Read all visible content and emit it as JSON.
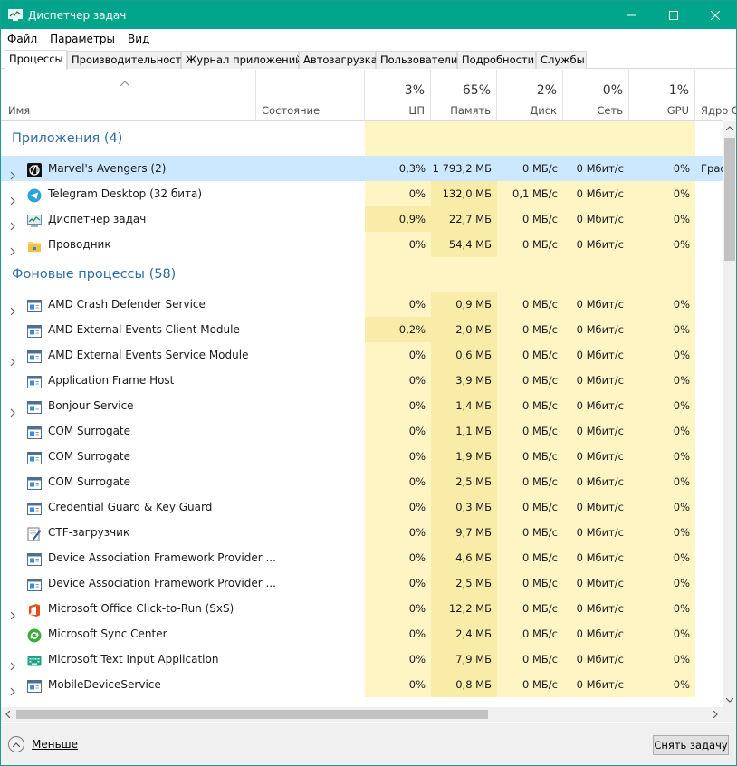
{
  "window": {
    "title": "Диспетчер задач"
  },
  "menu": [
    "Файл",
    "Параметры",
    "Вид"
  ],
  "tabs": [
    "Процессы",
    "Производительность",
    "Журнал приложений",
    "Автозагрузка",
    "Пользователи",
    "Подробности",
    "Службы"
  ],
  "header": {
    "name": "Имя",
    "status": "Состояние",
    "cpu": {
      "pct": "3%",
      "label": "ЦП"
    },
    "mem": {
      "pct": "65%",
      "label": "Память"
    },
    "disk": {
      "pct": "2%",
      "label": "Диск"
    },
    "net": {
      "pct": "0%",
      "label": "Сеть"
    },
    "gpu": {
      "pct": "1%",
      "label": "GPU"
    },
    "gpu_engine": "Ядро GPU"
  },
  "groups": {
    "apps": "Приложения (4)",
    "background": "Фоновые процессы (58)"
  },
  "apps": [
    {
      "name": "Marvel's Avengers (2)",
      "cpu": "0,3%",
      "mem": "1 793,2 МБ",
      "disk": "0 МБ/с",
      "net": "0 Мбит/с",
      "gpu": "0%",
      "engine": "Граф",
      "icon": "avengers-icon",
      "expand": true,
      "selected": true
    },
    {
      "name": "Telegram Desktop (32 бита)",
      "cpu": "0%",
      "mem": "132,0 МБ",
      "disk": "0,1 МБ/с",
      "net": "0 Мбит/с",
      "gpu": "0%",
      "engine": "",
      "icon": "telegram-icon",
      "expand": true
    },
    {
      "name": "Диспетчер задач",
      "cpu": "0,9%",
      "mem": "22,7 МБ",
      "disk": "0 МБ/с",
      "net": "0 Мбит/с",
      "gpu": "0%",
      "engine": "",
      "icon": "task-manager-icon",
      "expand": true
    },
    {
      "name": "Проводник",
      "cpu": "0%",
      "mem": "54,4 МБ",
      "disk": "0 МБ/с",
      "net": "0 Мбит/с",
      "gpu": "0%",
      "engine": "",
      "icon": "explorer-folder-icon",
      "expand": true
    }
  ],
  "background": [
    {
      "name": "AMD Crash Defender Service",
      "cpu": "0%",
      "mem": "0,9 МБ",
      "disk": "0 МБ/с",
      "net": "0 Мбит/с",
      "gpu": "0%",
      "icon": "service-icon",
      "expand": true
    },
    {
      "name": "AMD External Events Client Module",
      "cpu": "0,2%",
      "mem": "2,0 МБ",
      "disk": "0 МБ/с",
      "net": "0 Мбит/с",
      "gpu": "0%",
      "icon": "service-icon",
      "expand": false
    },
    {
      "name": "AMD External Events Service Module",
      "cpu": "0%",
      "mem": "0,6 МБ",
      "disk": "0 МБ/с",
      "net": "0 Мбит/с",
      "gpu": "0%",
      "icon": "service-icon",
      "expand": true
    },
    {
      "name": "Application Frame Host",
      "cpu": "0%",
      "mem": "3,9 МБ",
      "disk": "0 МБ/с",
      "net": "0 Мбит/с",
      "gpu": "0%",
      "icon": "service-icon",
      "expand": false
    },
    {
      "name": "Bonjour Service",
      "cpu": "0%",
      "mem": "1,4 МБ",
      "disk": "0 МБ/с",
      "net": "0 Мбит/с",
      "gpu": "0%",
      "icon": "service-icon",
      "expand": true
    },
    {
      "name": "COM Surrogate",
      "cpu": "0%",
      "mem": "1,1 МБ",
      "disk": "0 МБ/с",
      "net": "0 Мбит/с",
      "gpu": "0%",
      "icon": "service-icon",
      "expand": false
    },
    {
      "name": "COM Surrogate",
      "cpu": "0%",
      "mem": "1,9 МБ",
      "disk": "0 МБ/с",
      "net": "0 Мбит/с",
      "gpu": "0%",
      "icon": "service-icon",
      "expand": false
    },
    {
      "name": "COM Surrogate",
      "cpu": "0%",
      "mem": "2,5 МБ",
      "disk": "0 МБ/с",
      "net": "0 Мбит/с",
      "gpu": "0%",
      "icon": "service-icon",
      "expand": false
    },
    {
      "name": "Credential Guard & Key Guard",
      "cpu": "0%",
      "mem": "0,3 МБ",
      "disk": "0 МБ/с",
      "net": "0 Мбит/с",
      "gpu": "0%",
      "icon": "service-icon",
      "expand": false
    },
    {
      "name": "CTF-загрузчик",
      "cpu": "0%",
      "mem": "9,7 МБ",
      "disk": "0 МБ/с",
      "net": "0 Мбит/с",
      "gpu": "0%",
      "icon": "ctf-pen-icon",
      "expand": false
    },
    {
      "name": "Device Association Framework Provider ...",
      "cpu": "0%",
      "mem": "4,6 МБ",
      "disk": "0 МБ/с",
      "net": "0 Мбит/с",
      "gpu": "0%",
      "icon": "service-icon",
      "expand": false
    },
    {
      "name": "Device Association Framework Provider ...",
      "cpu": "0%",
      "mem": "2,5 МБ",
      "disk": "0 МБ/с",
      "net": "0 Мбит/с",
      "gpu": "0%",
      "icon": "service-icon",
      "expand": false
    },
    {
      "name": "Microsoft Office Click-to-Run (SxS)",
      "cpu": "0%",
      "mem": "12,2 МБ",
      "disk": "0 МБ/с",
      "net": "0 Мбит/с",
      "gpu": "0%",
      "icon": "office-icon",
      "expand": true
    },
    {
      "name": "Microsoft Sync Center",
      "cpu": "0%",
      "mem": "2,4 МБ",
      "disk": "0 МБ/с",
      "net": "0 Мбит/с",
      "gpu": "0%",
      "icon": "sync-center-icon",
      "expand": false
    },
    {
      "name": "Microsoft Text Input Application",
      "cpu": "0%",
      "mem": "7,9 МБ",
      "disk": "0 МБ/с",
      "net": "0 Мбит/с",
      "gpu": "0%",
      "icon": "text-input-icon",
      "expand": true
    },
    {
      "name": "MobileDeviceService",
      "cpu": "0%",
      "mem": "0,8 МБ",
      "disk": "0 МБ/с",
      "net": "0 Мбит/с",
      "gpu": "0%",
      "icon": "service-icon",
      "expand": true
    }
  ],
  "footer": {
    "less": "Меньше",
    "end_task": "Снять задачу"
  },
  "colors": {
    "titlebar": "#00a58c",
    "heat_low": "#fff4c4",
    "heat_mid": "#f9eca8",
    "heat_high": "#ffe9a7",
    "selected": "#cce8ff",
    "group_title": "#2e6ca6"
  }
}
